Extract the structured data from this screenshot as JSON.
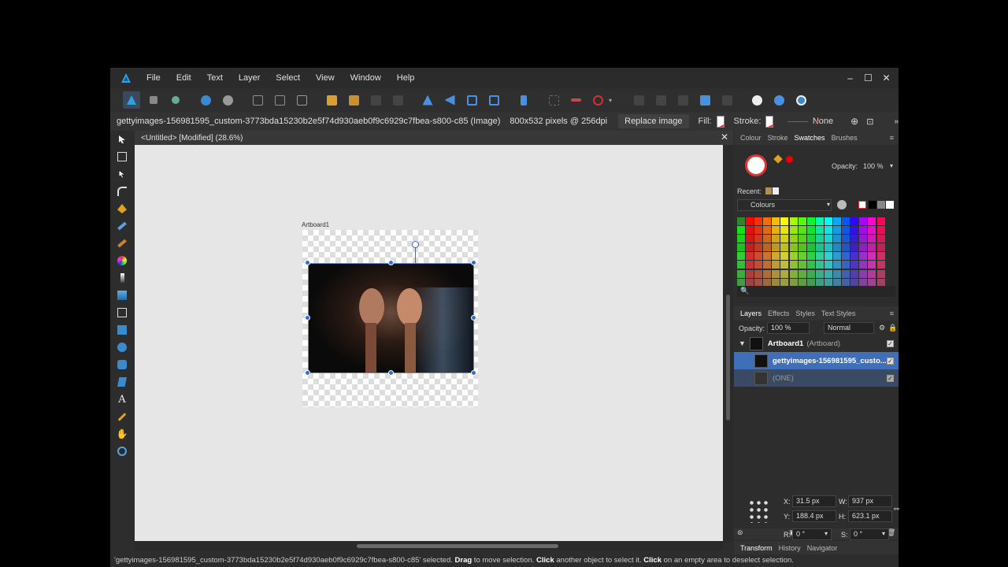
{
  "menu": [
    "File",
    "Edit",
    "Text",
    "Layer",
    "Select",
    "View",
    "Window",
    "Help"
  ],
  "window_controls": {
    "minimize": "–",
    "maximize": "☐",
    "close": "✕"
  },
  "context": {
    "filename": "gettyimages-156981595_custom-3773bda15230b2e5f74d930aeb0f9c6929c7fbea-s800-c85 (Image)",
    "dimensions": "800x532 pixels @ 256dpi",
    "replace_label": "Replace image",
    "fill_label": "Fill:",
    "stroke_label": "Stroke:",
    "stroke_value": "None"
  },
  "document": {
    "tab_title": "<Untitled> [Modified] (28.6%)",
    "close": "✕",
    "artboard_label": "Artboard1"
  },
  "color_panel": {
    "tabs": [
      "Colour",
      "Stroke",
      "Swatches",
      "Brushes"
    ],
    "active_tab": "Swatches",
    "opacity_label": "Opacity:",
    "opacity_value": "100 %",
    "recent_label": "Recent:",
    "palette_name": "Colours"
  },
  "layers_panel": {
    "tabs": [
      "Layers",
      "Effects",
      "Styles",
      "Text Styles"
    ],
    "active_tab": "Layers",
    "opacity_label": "Opacity:",
    "opacity_value": "100 %",
    "blend_mode": "Normal",
    "layers": [
      {
        "name": "Artboard1",
        "type": "(Artboard)"
      },
      {
        "name": "gettyimages-156981595_custo...",
        "type": ""
      },
      {
        "name": "(ONE)",
        "type": ""
      }
    ]
  },
  "transform_panel": {
    "tabs": [
      "Transform",
      "History",
      "Navigator"
    ],
    "active_tab": "Transform",
    "x_label": "X:",
    "x": "31.5 px",
    "y_label": "Y:",
    "y": "188.4 px",
    "w_label": "W:",
    "w": "937 px",
    "h_label": "H:",
    "h": "623.1 px",
    "r_label": "R:",
    "r": "0 °",
    "s_label": "S:",
    "s": "0 °"
  },
  "status": {
    "part1": "'gettyimages-156981595_custom-3773bda15230b2e5f74d930aeb0f9c6929c7fbea-s800-c85' selected. ",
    "drag": "Drag",
    "part2": " to move selection. ",
    "click1": "Click",
    "part3": " another object to select it. ",
    "click2": "Click",
    "part4": " on an empty area to deselect selection."
  },
  "colors": {
    "accent": "#2f6fd0",
    "selected_layer": "#3f6fb8"
  }
}
